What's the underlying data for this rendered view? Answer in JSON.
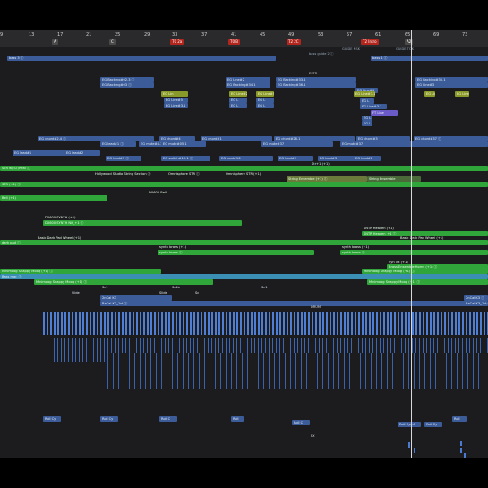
{
  "ruler": {
    "bars": [
      "9",
      "13",
      "17",
      "21",
      "25",
      "29",
      "33",
      "37",
      "41",
      "45",
      "49",
      "53",
      "57",
      "61",
      "65",
      "69",
      "73"
    ],
    "markers": [
      {
        "label": "A",
        "color": "#5a5a5a"
      },
      {
        "label": "C",
        "color": "#5a5a5a"
      },
      {
        "label": "T0 2a",
        "color": "#b3261e"
      },
      {
        "label": "T0 B",
        "color": "#b3261e"
      },
      {
        "label": "T2 2C",
        "color": "#b3261e"
      },
      {
        "label": "T2 Intro",
        "color": "#b3261e"
      },
      {
        "label": "A2",
        "color": "#5a5a5a"
      }
    ],
    "guides": [
      "GUIDE NSK",
      "GUIDE TOK"
    ]
  },
  "regions": [
    {
      "label": "bass 3  ⓘ",
      "style": "blue"
    },
    {
      "label": "bass guide 2  ⓘ",
      "style": "blue"
    },
    {
      "label": "bass 1  ⓘ",
      "style": "blue"
    },
    {
      "label": "ESTR",
      "style": "plain"
    },
    {
      "label": "EG Backing#02.3  ⓘ",
      "style": "blue"
    },
    {
      "label": "EG Backing#03  ⓘ",
      "style": "blue"
    },
    {
      "label": "EG Line#2",
      "style": "blue"
    },
    {
      "label": "EG Backing#34.1",
      "style": "blue"
    },
    {
      "label": "EG Backing#33.1",
      "style": "blue"
    },
    {
      "label": "EG Backing#36.1",
      "style": "blue"
    },
    {
      "label": "EG Line#4",
      "style": "blue"
    },
    {
      "label": "EG Backing#35.1",
      "style": "blue"
    },
    {
      "label": "EG Line#3",
      "style": "blue"
    },
    {
      "label": "EG Lin",
      "style": "olive"
    },
    {
      "label": "EG Line#2",
      "style": "olive"
    },
    {
      "label": "EG Line#5",
      "style": "olive"
    },
    {
      "label": "EG Line#3.1",
      "style": "olive"
    },
    {
      "label": "EG L",
      "style": "blue"
    },
    {
      "label": "FT Line",
      "style": "purple"
    },
    {
      "label": "EG chord#2.4  ⓘ",
      "style": "blue"
    },
    {
      "label": "EG chord#4",
      "style": "blue"
    },
    {
      "label": "EG chord#1",
      "style": "blue"
    },
    {
      "label": "EG chord#28.1",
      "style": "blue"
    },
    {
      "label": "EG chord#3",
      "style": "blue"
    },
    {
      "label": "EG chord#37  ⓘ",
      "style": "blue"
    },
    {
      "label": "EG lead#1  ⓘ",
      "style": "blue"
    },
    {
      "label": "EG mute#4.1",
      "style": "blue"
    },
    {
      "label": "EG mute#05.1",
      "style": "blue"
    },
    {
      "label": "EG mute#37",
      "style": "blue"
    },
    {
      "label": "EG lead#1",
      "style": "blue"
    },
    {
      "label": "EG lead#2",
      "style": "blue"
    },
    {
      "label": "EG lead#3  ⓘ",
      "style": "blue"
    },
    {
      "label": "EG switch#12.1  ⓘ",
      "style": "blue"
    },
    {
      "label": "EG lead#16",
      "style": "blue"
    },
    {
      "label": "EG lead#2",
      "style": "blue"
    },
    {
      "label": "EG lead#3",
      "style": "blue"
    },
    {
      "label": "EG lead#8",
      "style": "blue"
    },
    {
      "label": "Hollywood Studio String Section ⓘ",
      "style": "green"
    },
    {
      "label": "Omnisphere STR ⓘ",
      "style": "green"
    },
    {
      "label": "Omnisphere STR (+1)",
      "style": "green"
    },
    {
      "label": "Str+1 (+1)",
      "style": "green"
    },
    {
      "label": "STR w/ ST/Real  ⓘ",
      "style": "green"
    },
    {
      "label": "String Ensemble (+1)  ⓘ",
      "style": "green"
    },
    {
      "label": "String Ensemble",
      "style": "green"
    },
    {
      "label": "STR (+1)  ⓘ",
      "style": "green"
    },
    {
      "label": "DX600 Bell",
      "style": "green"
    },
    {
      "label": "Bell (+1)",
      "style": "green"
    },
    {
      "label": "DX600 SYNTH (+1)",
      "style": "green"
    },
    {
      "label": "DX600 SYNTH Nit_+1  ⓘ",
      "style": "green"
    },
    {
      "label": "SNTR Heaven (+1)",
      "style": "green"
    },
    {
      "label": "SNTR Heaven_+1  ⓘ",
      "style": "green"
    },
    {
      "label": "Basic Dark Pad Wheel (+1)",
      "style": "green"
    },
    {
      "label": "dark pad  ⓘ",
      "style": "green"
    },
    {
      "label": "Basic Dark Pad Wheel (+1)",
      "style": "green"
    },
    {
      "label": "synth brass (+1)",
      "style": "green"
    },
    {
      "label": "synth brass (+1)",
      "style": "green"
    },
    {
      "label": "synth brass  ⓘ",
      "style": "green"
    },
    {
      "label": "synth brass  ⓘ",
      "style": "green"
    },
    {
      "label": "Syn lift (+1)",
      "style": "green"
    },
    {
      "label": "Brass Ensemble Horns (+1)  ⓘ",
      "style": "green"
    },
    {
      "label": "Minimoog Snappy Moog (+1)  ⓘ",
      "style": "green"
    },
    {
      "label": "Minimoog Snappy Moog (+1)  ⓘ",
      "style": "green"
    },
    {
      "label": "Bass mar.  ⓘ",
      "style": "green"
    },
    {
      "label": "Minimoog Snappy Moog (+1)  ⓘ",
      "style": "green"
    },
    {
      "label": "Minimoog Snappy Moog (+1)  ⓘ",
      "style": "green"
    },
    {
      "label": "Sc1",
      "style": "blue"
    },
    {
      "label": "Sc1b",
      "style": "blue"
    },
    {
      "label": "Sc1",
      "style": "blue"
    },
    {
      "label": "Slide",
      "style": "blue"
    },
    {
      "label": "Slide",
      "style": "blue"
    },
    {
      "label": "Sc",
      "style": "blue"
    },
    {
      "label": "2nCal K3",
      "style": "blue"
    },
    {
      "label": "2nCal K3  ⓘ",
      "style": "blue"
    },
    {
      "label": "BaCal K3_1st  ⓘ",
      "style": "blue"
    },
    {
      "label": "BaCal K3_1st  ⓘ",
      "style": "blue"
    },
    {
      "label": "DRUM",
      "style": "plain"
    },
    {
      "label": "Roll Cy",
      "style": "blue"
    },
    {
      "label": "Roll Cy",
      "style": "blue"
    },
    {
      "label": "Roll C",
      "style": "blue"
    },
    {
      "label": "Roll",
      "style": "blue"
    },
    {
      "label": "Roll C",
      "style": "blue"
    },
    {
      "label": "Roll Cym1",
      "style": "blue"
    },
    {
      "label": "Roll Cy",
      "style": "blue"
    },
    {
      "label": "Roll",
      "style": "blue"
    },
    {
      "label": "FX",
      "style": "plain"
    }
  ],
  "playhead": {
    "label": "playhead"
  }
}
